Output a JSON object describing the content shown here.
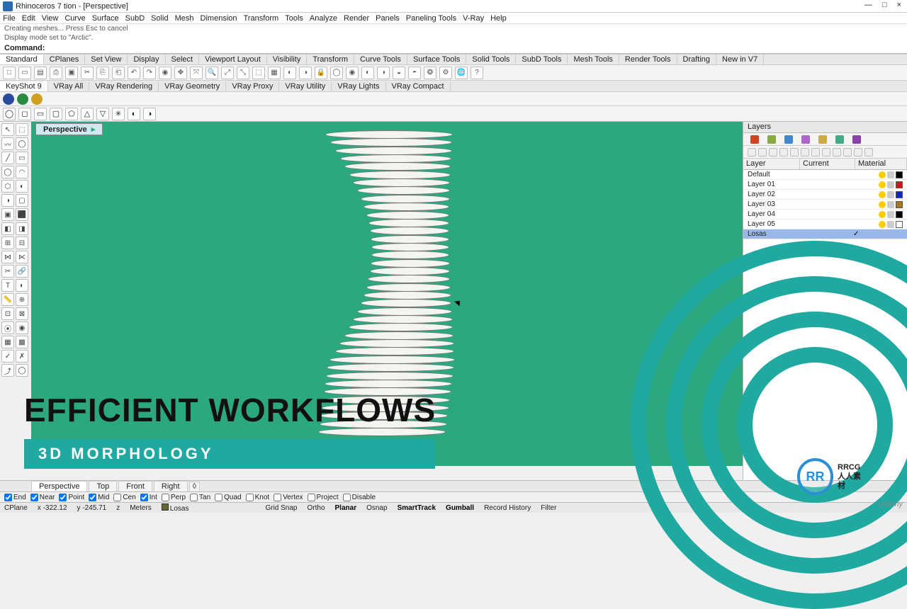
{
  "window": {
    "title": "Rhinoceros 7 tion - [Perspective]",
    "min": "—",
    "max": "□",
    "close": "×"
  },
  "menu": [
    "File",
    "Edit",
    "View",
    "Curve",
    "Surface",
    "SubD",
    "Solid",
    "Mesh",
    "Dimension",
    "Transform",
    "Tools",
    "Analyze",
    "Render",
    "Panels",
    "Paneling Tools",
    "V-Ray",
    "Help"
  ],
  "cmd_history": [
    "Creating meshes... Press Esc to cancel",
    "Display mode set to \"Arctic\"."
  ],
  "cmd_label": "Command:",
  "cmd_value": "",
  "tabsets": [
    "Standard",
    "CPlanes",
    "Set View",
    "Display",
    "Select",
    "Viewport Layout",
    "Visibility",
    "Transform",
    "Curve Tools",
    "Surface Tools",
    "Solid Tools",
    "SubD Tools",
    "Mesh Tools",
    "Render Tools",
    "Drafting",
    "New in V7"
  ],
  "vray_tabs": [
    "KeyShot 9",
    "VRay All",
    "VRay Rendering",
    "VRay Geometry",
    "VRay Proxy",
    "VRay Utility",
    "VRay Lights",
    "VRay Compact"
  ],
  "viewport": {
    "label": "Perspective",
    "dropdown": "▸"
  },
  "layers_panel": {
    "title": "Layers",
    "columns": {
      "layer": "Layer",
      "current": "Current",
      "material": "Material"
    },
    "rows": [
      {
        "name": "Default",
        "color": "#000000",
        "current": false
      },
      {
        "name": "Layer 01",
        "color": "#d01818",
        "current": false
      },
      {
        "name": "Layer 02",
        "color": "#1028c0",
        "current": false
      },
      {
        "name": "Layer 03",
        "color": "#a87818",
        "current": false
      },
      {
        "name": "Layer 04",
        "color": "#000000",
        "current": false
      },
      {
        "name": "Layer 05",
        "color": "#ffffff",
        "current": false
      },
      {
        "name": "Losas",
        "color": "",
        "current": true
      }
    ]
  },
  "overlay": {
    "title": "EFFICIENT WORKFLOWS",
    "subtitle": "3D MORPHOLOGY"
  },
  "branding": {
    "text": "RRCG",
    "sub": "人人素材",
    "udemy": "Udemy"
  },
  "view_tabs": [
    "Perspective",
    "Top",
    "Front",
    "Right"
  ],
  "osnaps": [
    {
      "label": "End",
      "checked": true
    },
    {
      "label": "Near",
      "checked": true
    },
    {
      "label": "Point",
      "checked": true
    },
    {
      "label": "Mid",
      "checked": true
    },
    {
      "label": "Cen",
      "checked": false
    },
    {
      "label": "Int",
      "checked": true
    },
    {
      "label": "Perp",
      "checked": false
    },
    {
      "label": "Tan",
      "checked": false
    },
    {
      "label": "Quad",
      "checked": false
    },
    {
      "label": "Knot",
      "checked": false
    },
    {
      "label": "Vertex",
      "checked": false
    },
    {
      "label": "Project",
      "checked": false
    },
    {
      "label": "Disable",
      "checked": false
    }
  ],
  "status": {
    "cplane": "CPlane",
    "x": "x -322.12",
    "y": "y -245.71",
    "z": "z",
    "units": "Meters",
    "layer": "Losas",
    "toggles": [
      {
        "label": "Grid Snap",
        "on": false
      },
      {
        "label": "Ortho",
        "on": false
      },
      {
        "label": "Planar",
        "on": true
      },
      {
        "label": "Osnap",
        "on": false
      },
      {
        "label": "SmartTrack",
        "on": true
      },
      {
        "label": "Gumball",
        "on": true
      },
      {
        "label": "Record History",
        "on": false
      },
      {
        "label": "Filter",
        "on": false
      }
    ]
  },
  "icons": {
    "std": [
      "□",
      "▭",
      "▤",
      "⎙",
      "▣",
      "✂",
      "⎘",
      "⎗",
      "↶",
      "↷",
      "◉",
      "✥",
      "⤧",
      "🔍",
      "⤢",
      "⤡",
      "⬚",
      "▦",
      "◐",
      "◑",
      "🔒",
      "◯",
      "◉",
      "◐",
      "◑",
      "◒",
      "◓",
      "❂",
      "⚙",
      "🌐",
      "?"
    ],
    "vray": [
      "#2a4aa0",
      "#2a8a40",
      "#d0a020"
    ],
    "sub": [
      "◯",
      "◻",
      "▭",
      "▢",
      "⬠",
      "△",
      "▽",
      "✳",
      "◐",
      "◑"
    ],
    "left": [
      "↖",
      "⬚",
      "〰",
      "◯",
      "╱",
      "▭",
      "◯",
      "◠",
      "⬡",
      "◐",
      "◑",
      "▢",
      "▣",
      "⬛",
      "◧",
      "◨",
      "⊞",
      "⊟",
      "⋈",
      "⋉",
      "✂",
      "🔗",
      "T",
      "◐",
      "📏",
      "⊕",
      "⊡",
      "⊠",
      "⦿",
      "◉",
      "▦",
      "▩",
      "✓",
      "✗",
      "⤴",
      "◯"
    ],
    "rp1": [
      "#cc4422",
      "#88aa44",
      "#4488cc",
      "#aa66cc",
      "#ccaa44",
      "#44aa88",
      "#8844aa"
    ]
  }
}
